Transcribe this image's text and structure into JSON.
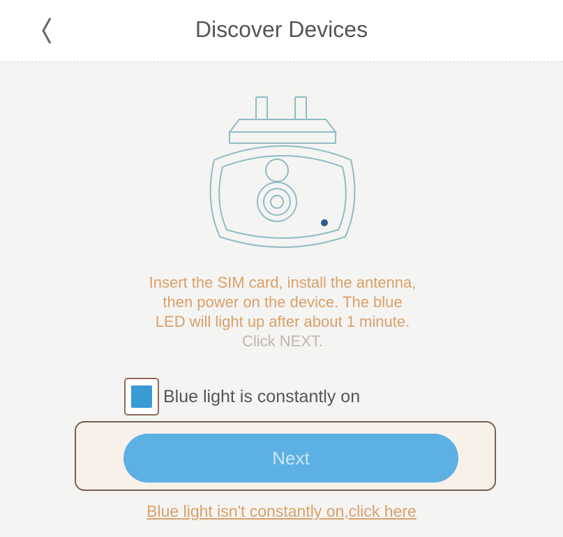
{
  "header": {
    "title": "Discover Devices",
    "back_icon": "chevron-left-icon"
  },
  "illustration": {
    "icon": "camera-device-icon",
    "line_color": "#8fbcc2",
    "led_color": "#2b5c8a"
  },
  "message": {
    "lines": [
      "Insert the SIM card, install the antenna,",
      "then power on the device. The blue",
      "LED will light up after about 1 minute.",
      "Click NEXT."
    ]
  },
  "checkbox": {
    "label": "Blue light is constantly on",
    "checked": true
  },
  "next_button": {
    "label": "Next"
  },
  "help_link": {
    "text": "Blue light isn't constantly on,click here"
  },
  "colors": {
    "accent": "#5cb0e4",
    "message_text": "#d9a06a",
    "background": "#f4f4f2"
  }
}
